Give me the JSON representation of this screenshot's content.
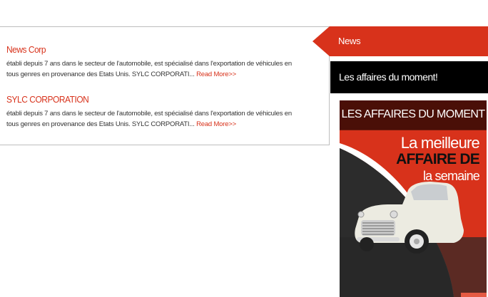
{
  "news": {
    "items": [
      {
        "title": "News Corp",
        "excerpt": "établi depuis 7 ans dans le secteur de l'automobile, est spécialisé dans l'exportation de véhicules en tous genres en provenance des Etats Unis. SYLC CORPORATI...",
        "read_more": "Read More>>"
      },
      {
        "title": "SYLC CORPORATION",
        "excerpt": "établi depuis 7 ans dans le secteur de l'automobile, est spécialisé dans l'exportation de véhicules en tous genres en provenance des Etats Unis. SYLC CORPORATI...",
        "read_more": "Read More>>"
      }
    ]
  },
  "sidebar": {
    "news_tab": "News",
    "deals_bar": "Les affaires du moment!",
    "promo": {
      "heading": "LES AFFAIRES DU MOMENT",
      "line1": "La meilleure",
      "line2": "AFFAIRE DE",
      "line3": "la semaine"
    }
  },
  "colors": {
    "accent": "#d8321b",
    "dark": "#000000",
    "promo_header": "#4a0f07"
  }
}
